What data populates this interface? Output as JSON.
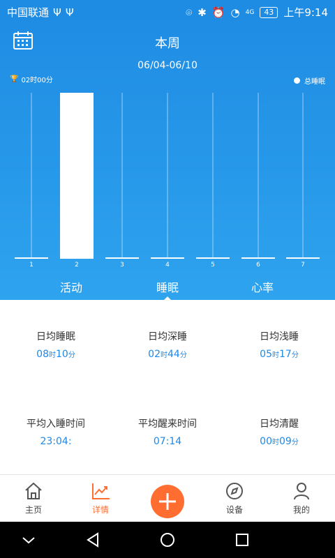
{
  "status": {
    "carrier": "中国联通",
    "usb_icons": [
      "usb-icon",
      "usb-icon"
    ],
    "battery": "43",
    "time": "上午9:14",
    "network": "4G"
  },
  "header": {
    "title": "本周",
    "date_range": "06/04-06/10",
    "avg_label": "02时00分",
    "legend": "总睡眠"
  },
  "chart_data": {
    "type": "bar",
    "categories": [
      "1",
      "2",
      "3",
      "4",
      "5",
      "6",
      "7"
    ],
    "series": [
      {
        "name": "总睡眠",
        "values": [
          0,
          8.1667,
          0,
          0,
          0,
          0,
          0
        ]
      }
    ],
    "ylim": [
      0,
      8.1667
    ],
    "xlabel": "",
    "ylabel": ""
  },
  "tabs": [
    {
      "label": "活动"
    },
    {
      "label": "睡眠"
    },
    {
      "label": "心率"
    }
  ],
  "stats": [
    {
      "label": "日均睡眠",
      "h": "08",
      "hs": "时",
      "m": "10",
      "ms": "分"
    },
    {
      "label": "日均深睡",
      "h": "02",
      "hs": "时",
      "m": "44",
      "ms": "分"
    },
    {
      "label": "日均浅睡",
      "h": "05",
      "hs": "时",
      "m": "17",
      "ms": "分"
    },
    {
      "label": "平均入睡时间",
      "value": "23:04:"
    },
    {
      "label": "平均醒来时间",
      "value": "07:14"
    },
    {
      "label": "日均清醒",
      "h": "00",
      "hs": "时",
      "m": "09",
      "ms": "分"
    }
  ],
  "nav": [
    {
      "label": "主页"
    },
    {
      "label": "详情"
    },
    {
      "label": "设备"
    },
    {
      "label": "我的"
    }
  ]
}
